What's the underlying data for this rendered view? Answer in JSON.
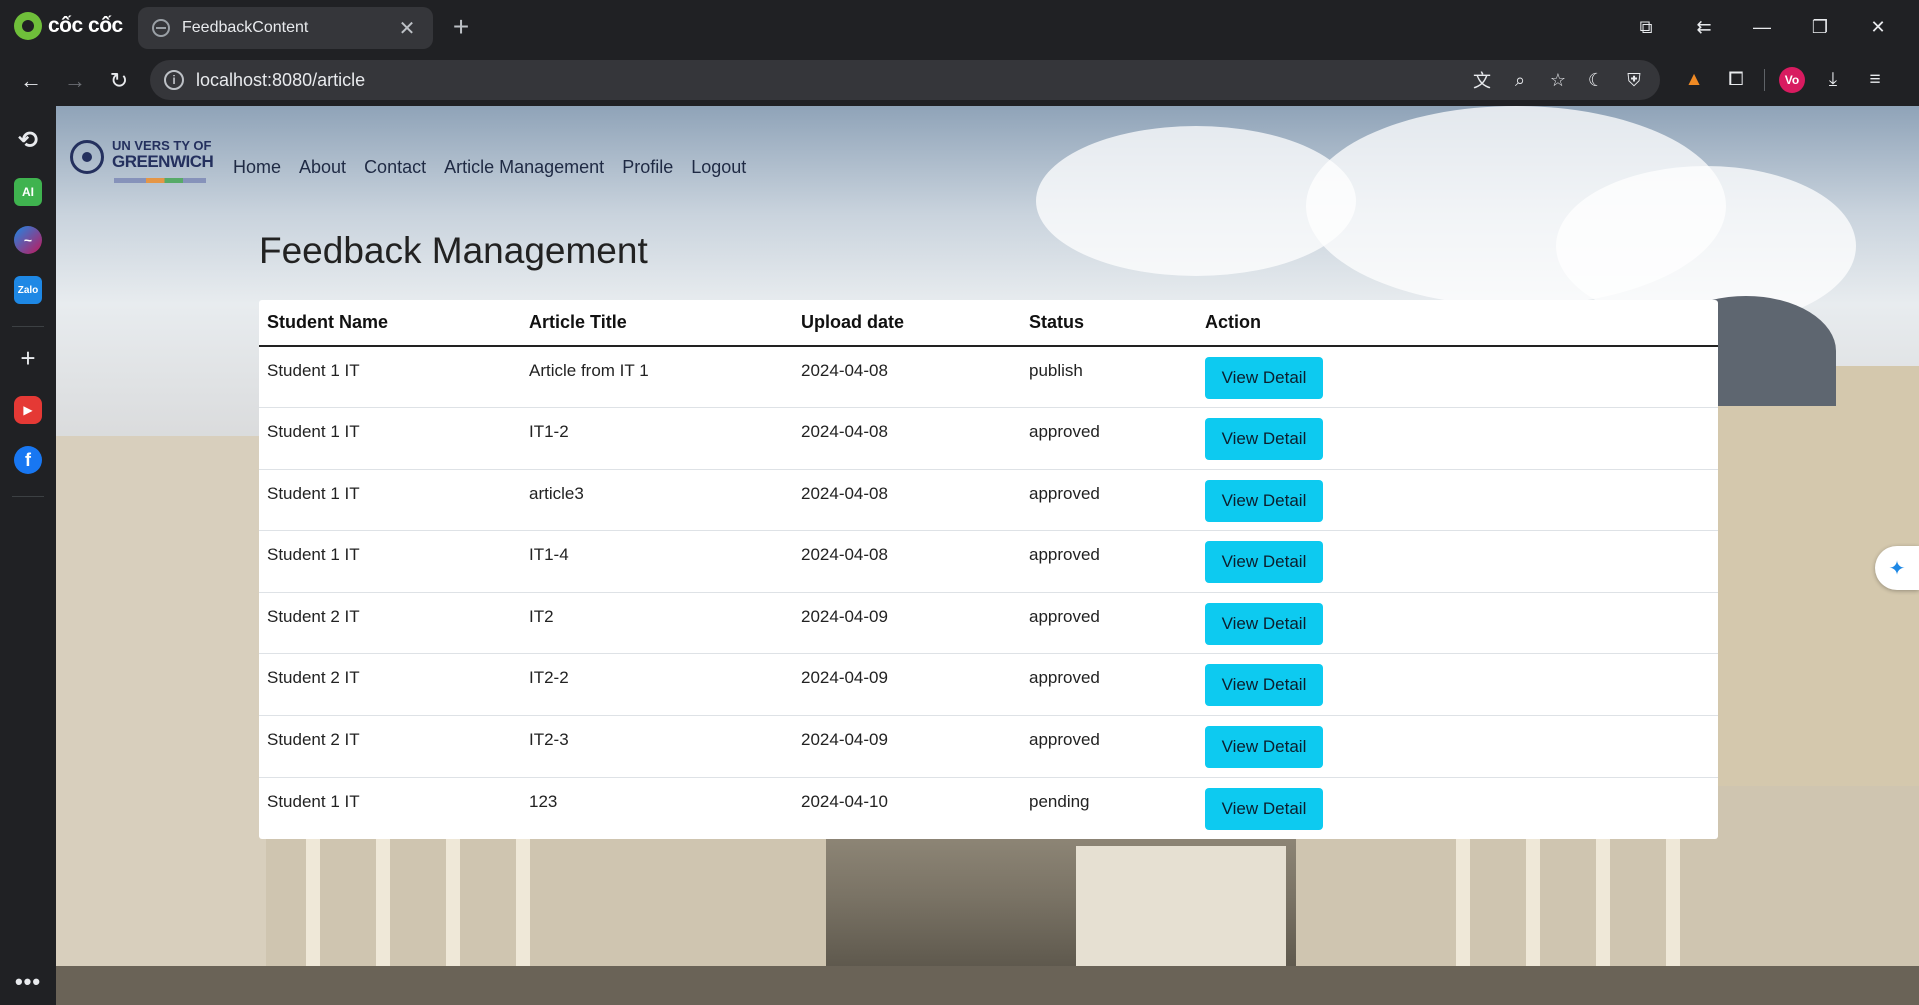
{
  "browser": {
    "brand": "cốc cốc",
    "tab_title": "FeedbackContent",
    "url": "localhost:8080/article",
    "profile_initials": "Vo"
  },
  "nav": {
    "items": [
      "Home",
      "About",
      "Contact",
      "Article Management",
      "Profile",
      "Logout"
    ]
  },
  "logo": {
    "line1": "UN VERS TY OF",
    "line2": "GREENWICH"
  },
  "page": {
    "title": "Feedback Management"
  },
  "table": {
    "headers": [
      "Student Name",
      "Article Title",
      "Upload date",
      "Status",
      "Action"
    ],
    "rows": [
      {
        "student": "Student 1 IT",
        "title": "Article from IT 1",
        "date": "2024-04-08",
        "status": "publish",
        "action": "View Detail"
      },
      {
        "student": "Student 1 IT",
        "title": "IT1-2",
        "date": "2024-04-08",
        "status": "approved",
        "action": "View Detail"
      },
      {
        "student": "Student 1 IT",
        "title": "article3",
        "date": "2024-04-08",
        "status": "approved",
        "action": "View Detail"
      },
      {
        "student": "Student 1 IT",
        "title": "IT1-4",
        "date": "2024-04-08",
        "status": "approved",
        "action": "View Detail"
      },
      {
        "student": "Student 2 IT",
        "title": "IT2",
        "date": "2024-04-09",
        "status": "approved",
        "action": "View Detail"
      },
      {
        "student": "Student 2 IT",
        "title": "IT2-2",
        "date": "2024-04-09",
        "status": "approved",
        "action": "View Detail"
      },
      {
        "student": "Student 2 IT",
        "title": "IT2-3",
        "date": "2024-04-09",
        "status": "approved",
        "action": "View Detail"
      },
      {
        "student": "Student 1 IT",
        "title": "123",
        "date": "2024-04-10",
        "status": "pending",
        "action": "View Detail"
      }
    ]
  },
  "colors": {
    "button": "#0dcaf0",
    "browser_bg": "#202124"
  }
}
